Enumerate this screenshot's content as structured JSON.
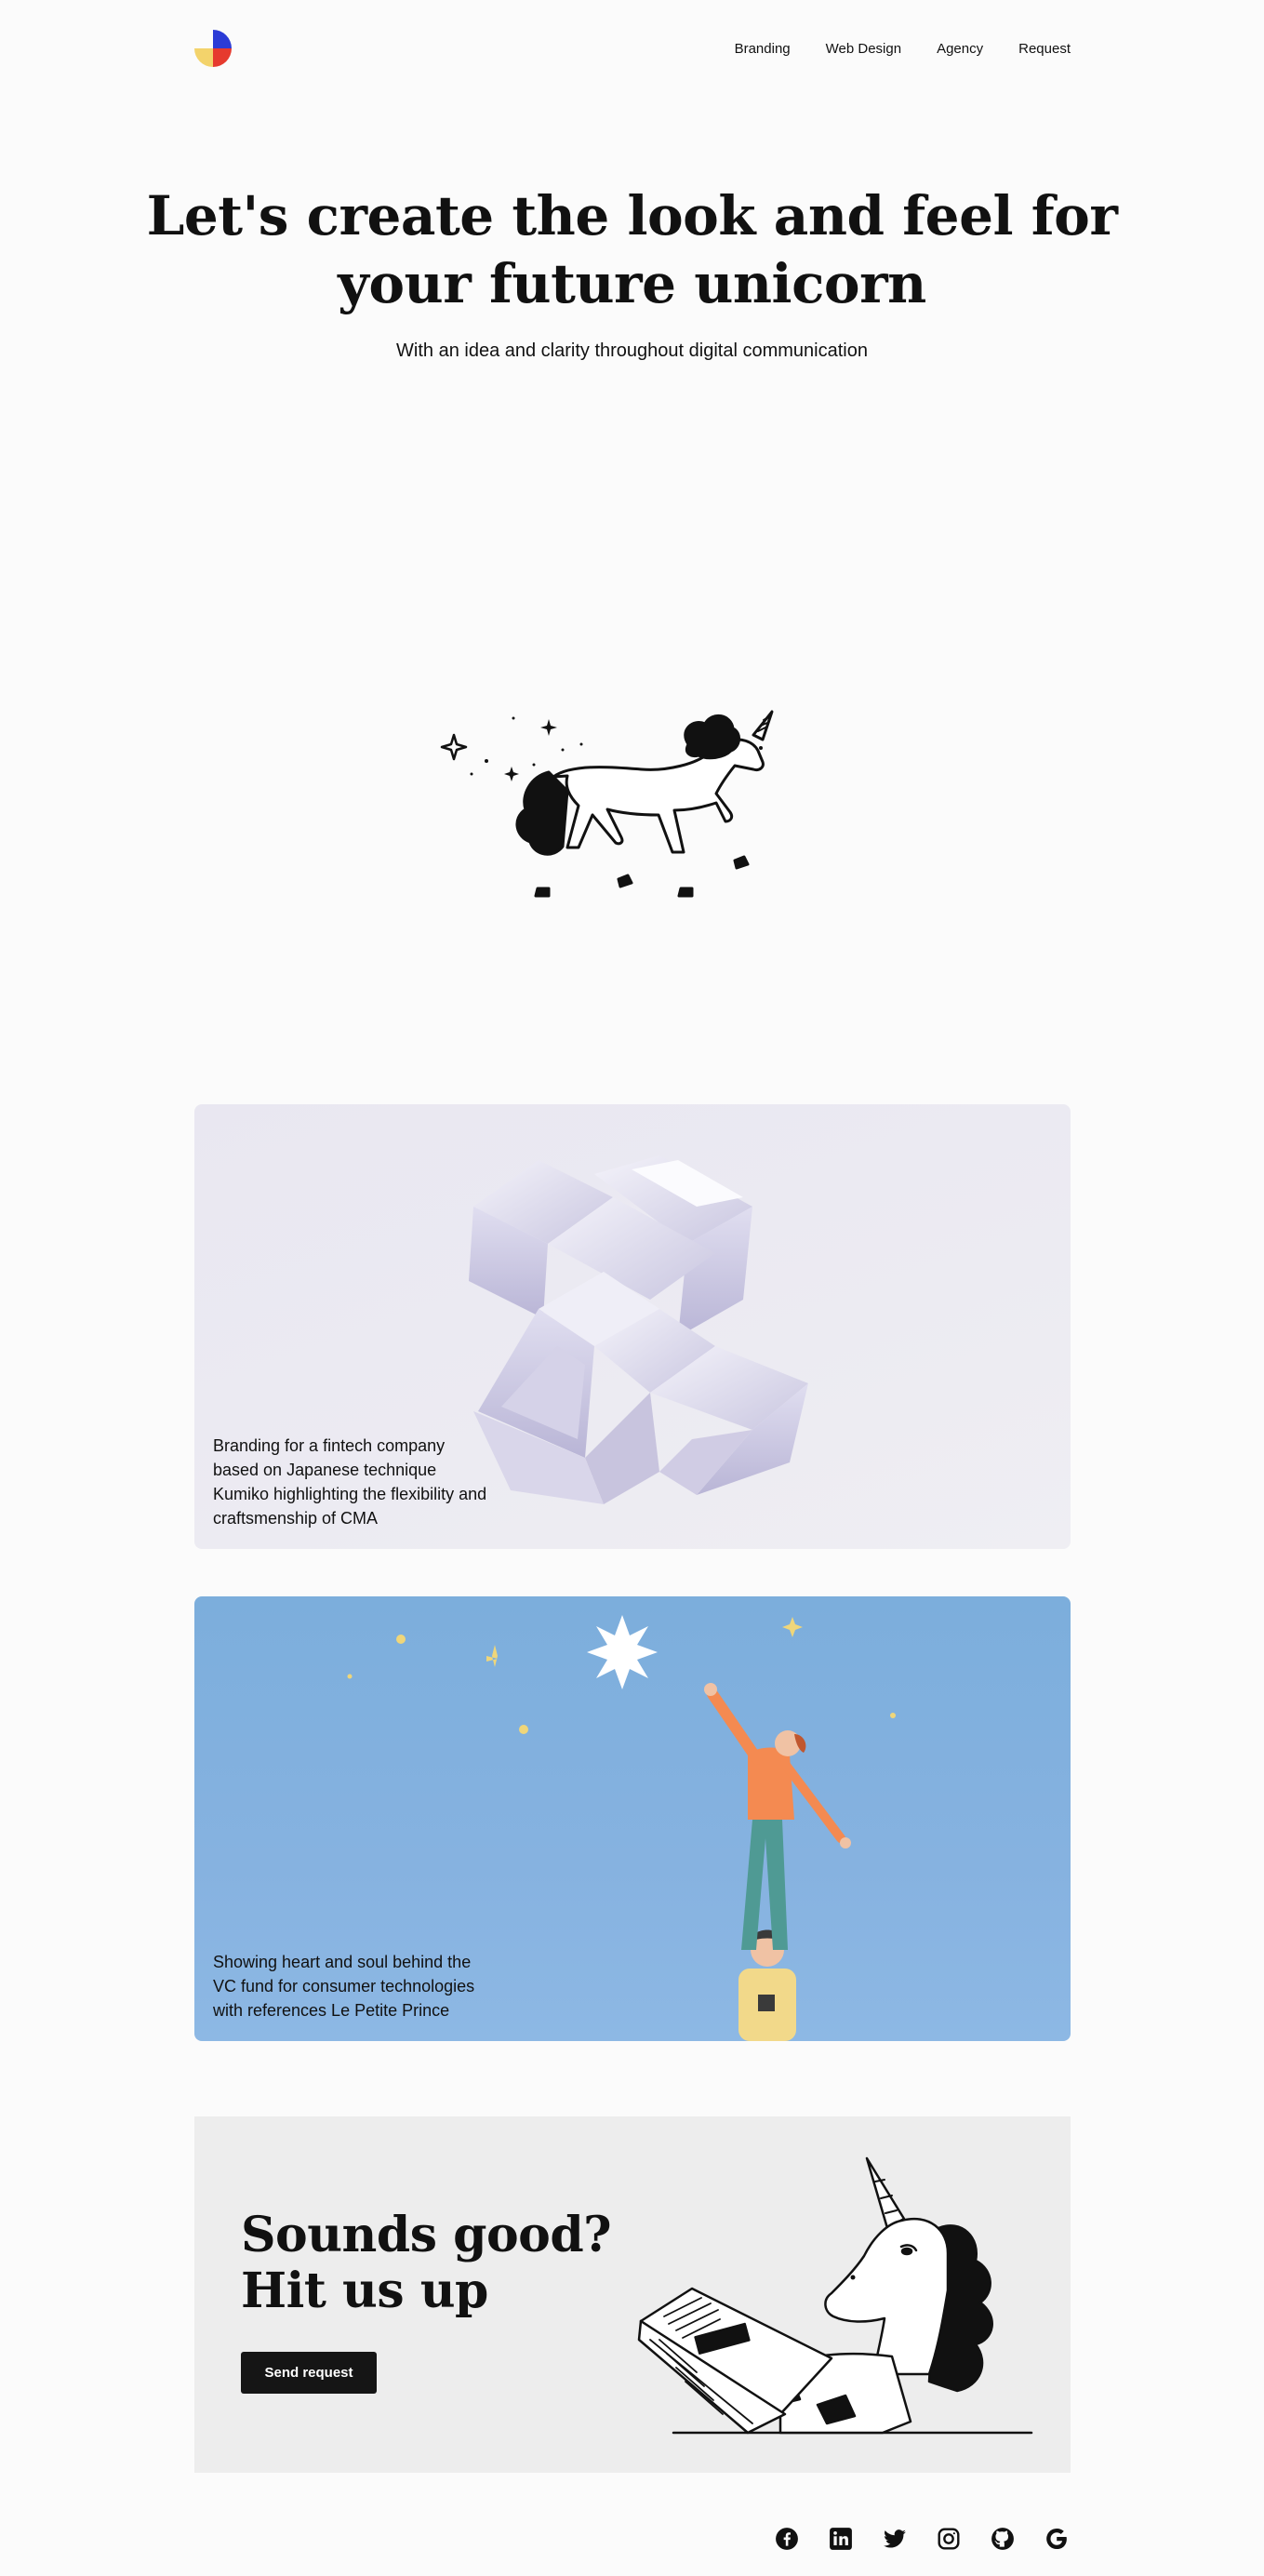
{
  "nav": {
    "items": [
      "Branding",
      "Web Design",
      "Agency",
      "Request"
    ]
  },
  "hero": {
    "title": "Let's create the look and feel for your future unicorn",
    "subtitle": "With an idea and clarity throughout digital communication"
  },
  "cards": [
    {
      "caption": "Branding for a fintech company based on Japanese technique Kumiko highlighting the flexibility and craftsmenship of CMA"
    },
    {
      "caption": "Showing heart and soul behind the VC fund for consumer technologies with references Le Petite Prince"
    }
  ],
  "cta": {
    "title_line1": "Sounds good?",
    "title_line2": "Hit us up",
    "button": "Send request"
  },
  "socials": [
    "facebook-icon",
    "linkedin-icon",
    "twitter-icon",
    "instagram-icon",
    "github-icon",
    "google-icon"
  ],
  "colors": {
    "logo_blue": "#2b3bd6",
    "logo_red": "#e63a2e",
    "logo_yellow": "#f3d36b",
    "card2_bg": "#86b2e0",
    "cta_bg": "#ededed",
    "button_bg": "#151515"
  }
}
